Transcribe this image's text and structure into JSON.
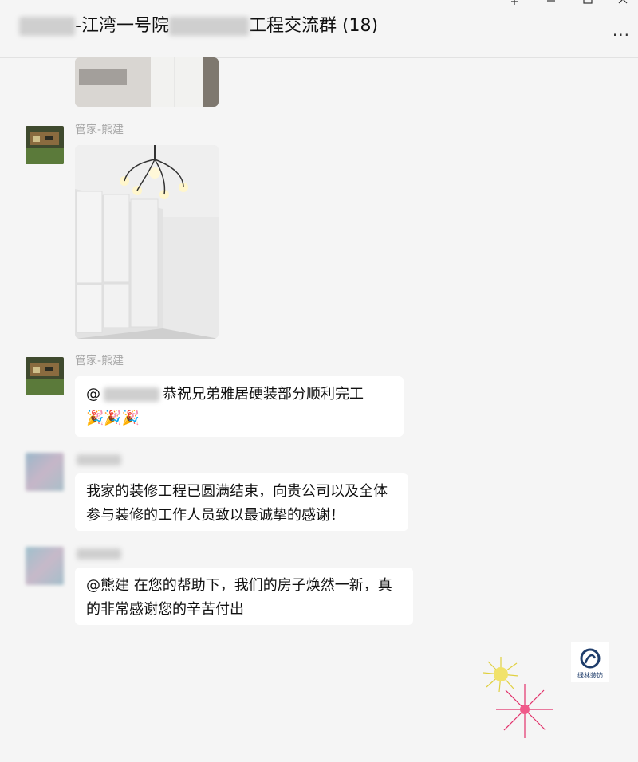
{
  "window": {
    "title_suffix": "工程交流群 (18)",
    "title_middle": "-江湾一号院",
    "controls": [
      "minimize",
      "maximize",
      "close"
    ],
    "more_label": "..."
  },
  "messages": [
    {
      "sender": "管家-熊建",
      "type": "image"
    },
    {
      "sender": "管家-熊建",
      "type": "text",
      "mention_prefix": "@",
      "text": "恭祝兄弟雅居硬装部分顺利完工",
      "emojis": "🎉🎉🎉"
    },
    {
      "type": "text",
      "text": "我家的装修工程已圆满结束，向贵公司以及全体参与装修的工作人员致以最诚挚的感谢！"
    },
    {
      "type": "text",
      "text": "@熊建 在您的帮助下，我们的房子焕然一新，真的非常感谢您的辛苦付出"
    }
  ],
  "watermark_text": "绿林装饰",
  "colors": {
    "background": "#f5f5f5",
    "bubble": "#ffffff",
    "sender": "#a8a8a8"
  }
}
